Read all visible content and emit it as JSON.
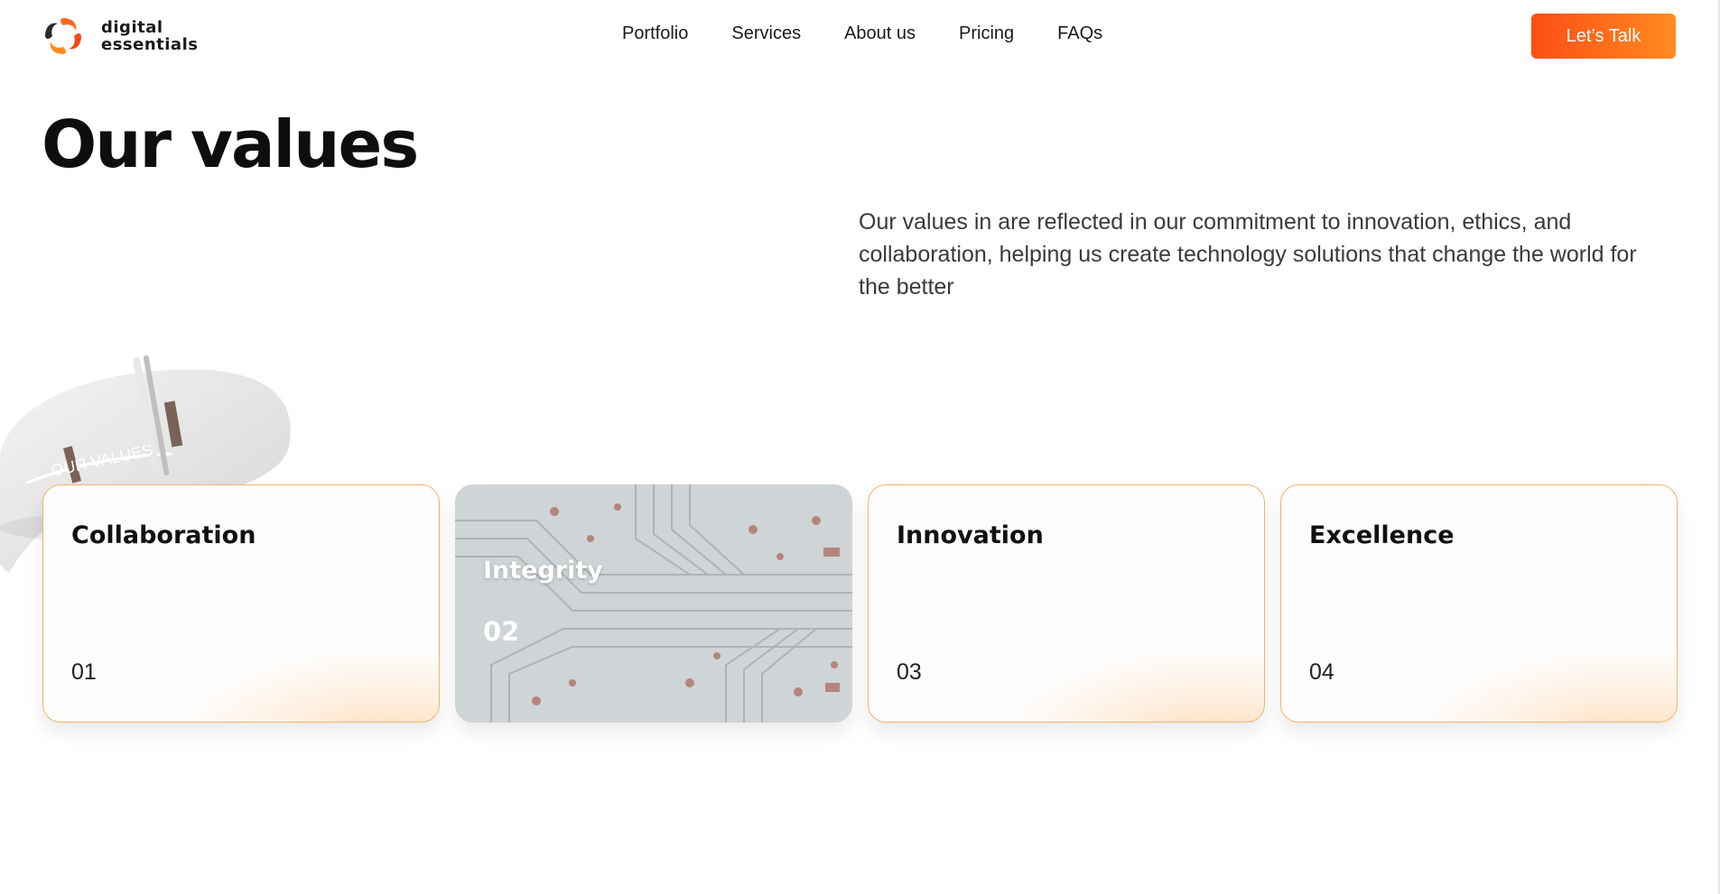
{
  "brand": {
    "line1": "digital",
    "line2": "essentials"
  },
  "nav": {
    "items": [
      "Portfolio",
      "Services",
      "About us",
      "Pricing",
      "FAQs"
    ]
  },
  "cta": {
    "label": "Let’s Talk"
  },
  "page": {
    "title": "Our values",
    "intro": "Our values in are reflected in our commitment to innovation, ethics, and collaboration, helping us create technology solutions that change the world for the better"
  },
  "decoration": {
    "label": "OUR VALUES"
  },
  "values": [
    {
      "title": "Collaboration",
      "number": "01"
    },
    {
      "title": "Integrity",
      "number": "02"
    },
    {
      "title": "Innovation",
      "number": "03"
    },
    {
      "title": "Excellence",
      "number": "04"
    }
  ],
  "colors": {
    "accent_start": "#fd4d14",
    "accent_end": "#ff8b20",
    "card_border": "#f6b26b"
  }
}
